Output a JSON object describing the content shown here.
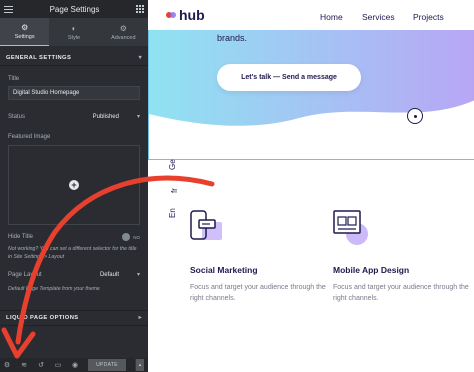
{
  "sidebar": {
    "header_title": "Page Settings",
    "tabs": [
      {
        "label": "Settings",
        "icon": "gear-icon"
      },
      {
        "label": "Style",
        "icon": "half-circle-icon"
      },
      {
        "label": "Advanced",
        "icon": "gear-icon"
      }
    ],
    "general_settings": "GENERAL SETTINGS",
    "title_label": "Title",
    "title_value": "Digital Studio Homepage",
    "status_label": "Status",
    "status_value": "Published",
    "featured_image_label": "Featured Image",
    "hide_title_label": "Hide Title",
    "hide_title_value": "NO",
    "hide_title_help": "Not working? You can set a different selector for the title in Site Settings > Layout",
    "page_layout_label": "Page Layout",
    "page_layout_value": "Default",
    "page_layout_help": "Default Page Template from your theme",
    "lqd_section": "LIQUID PAGE OPTIONS",
    "update_label": "UPDATE"
  },
  "preview": {
    "logo_text": "hub",
    "nav_items": [
      "Home",
      "Services",
      "Projects"
    ],
    "hero_text": "brands.",
    "cta_label": "Let's talk — Send a message",
    "vertical_labels": [
      "Ge",
      "fr",
      "En"
    ],
    "features": [
      {
        "title": "Social Marketing",
        "desc": "Focus and target your audience through the right channels."
      },
      {
        "title": "Mobile App Design",
        "desc": "Focus and target your audience through the right channels."
      }
    ]
  },
  "colors": {
    "sidebar_bg": "#2b2c31",
    "accent_red": "#e8402f",
    "hero_gradient_start": "#8fe3f2",
    "hero_gradient_end": "#b8a6f5",
    "brand_navy": "#1e1a4d",
    "purple": "#8a6ef0"
  }
}
